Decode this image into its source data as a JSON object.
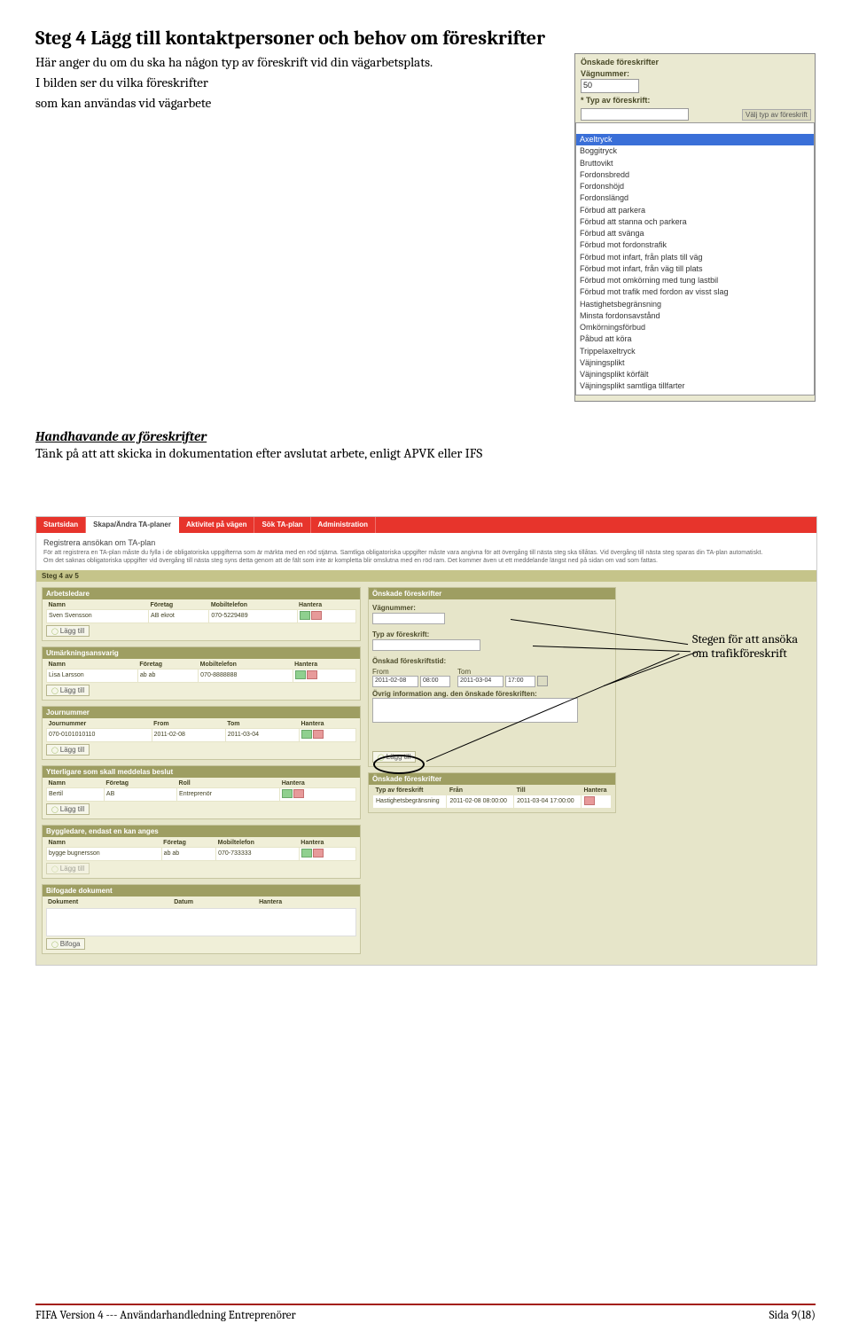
{
  "heading": "Steg 4 Lägg till kontaktpersoner och behov om föreskrifter",
  "intro_line": "Här anger du om du ska ha någon typ av föreskrift vid din vägarbetsplats.",
  "intro_line2a": "I bilden ser du vilka föreskrifter",
  "intro_line2b": "som kan användas vid vägarbete",
  "dropdown": {
    "top_label": "Önskade föreskrifter",
    "vagnummer_label": "Vägnummer:",
    "vagnummer_value": "50",
    "typ_label": "* Typ av föreskrift:",
    "hint": "Välj typ av föreskrift",
    "options": [
      "Axeltryck",
      "Boggitryck",
      "Bruttovikt",
      "Fordonsbredd",
      "Fordonshöjd",
      "Fordonslängd",
      "Förbud att parkera",
      "Förbud att stanna och parkera",
      "Förbud att svänga",
      "Förbud mot fordonstrafik",
      "Förbud mot infart, från plats till väg",
      "Förbud mot infart, från väg till plats",
      "Förbud mot omkörning med tung lastbil",
      "Förbud mot trafik med fordon av visst slag",
      "Hastighetsbegränsning",
      "Minsta fordonsavstånd",
      "Omkörningsförbud",
      "Påbud att köra",
      "Trippelaxeltryck",
      "Väjningsplikt",
      "Väjningsplikt körfält",
      "Väjningsplikt samtliga tillfarter"
    ]
  },
  "sub_heading": "Handhavande av föreskrifter",
  "sub_text": "Tänk på att att skicka in dokumentation efter avslutat arbete, enligt APVK eller IFS",
  "app_shot": {
    "nav": [
      "Startsidan",
      "Skapa/Ändra TA-planer",
      "Aktivitet på vägen",
      "Sök TA-plan",
      "Administration"
    ],
    "reg_title": "Registrera ansökan om TA-plan",
    "reg_desc1": "För att registrera en TA-plan måste du fylla i de obligatoriska uppgifterna som är märkta med en röd stjärna. Samtliga obligatoriska uppgifter måste vara angivna för att övergång till nästa steg ska tillåtas. Vid övergång till nästa steg sparas din TA-plan automatiskt.",
    "reg_desc2": "Om det saknas obligatoriska uppgifter vid övergång till nästa steg syns detta genom att de fält som inte är kompletta blir omslutna med en röd ram. Det kommer även ut ett meddelande längst ned på sidan om vad som fattas.",
    "step_bar": "Steg 4 av 5",
    "arbetsledare": {
      "title": "Arbetsledare",
      "hdr": [
        "Namn",
        "Företag",
        "Mobiltelefon",
        "Hantera"
      ],
      "row": [
        "Sven Svensson",
        "AB ekrot",
        "070-5229489",
        ""
      ]
    },
    "utmarkning": {
      "title": "Utmärkningsansvarig",
      "hdr": [
        "Namn",
        "Företag",
        "Mobiltelefon",
        "Hantera"
      ],
      "row": [
        "Lisa Larsson",
        "ab ab",
        "070-8888888",
        ""
      ]
    },
    "journummer": {
      "title": "Journummer",
      "hdr": [
        "Journummer",
        "From",
        "Tom",
        "Hantera"
      ],
      "row": [
        "070-0101010110",
        "2011-02-08",
        "2011-03-04",
        ""
      ]
    },
    "ytterligare": {
      "title": "Ytterligare som skall meddelas beslut",
      "hdr": [
        "Namn",
        "Företag",
        "Roll",
        "Hantera"
      ],
      "row": [
        "Bertil",
        "AB",
        "Entreprenör",
        ""
      ]
    },
    "byggledare": {
      "title": "Byggledare, endast en kan anges",
      "hdr": [
        "Namn",
        "Företag",
        "Mobiltelefon",
        "Hantera"
      ],
      "row": [
        "bygge bugnersson",
        "ab ab",
        "070-733333",
        ""
      ]
    },
    "bifogade": {
      "title": "Bifogade dokument",
      "hdr": [
        "Dokument",
        "Datum",
        "Hantera"
      ]
    },
    "btn_lagg": "Lägg till",
    "btn_bifoga": "Bifoga",
    "onskade": {
      "title": "Önskade föreskrifter",
      "vagnr_label": "Vägnummer:",
      "typ_label": "Typ av föreskrift:",
      "tid_label": "Önskad föreskriftstid:",
      "from_label": "From",
      "tom_label": "Tom",
      "from_date": "2011-02-08",
      "from_time": "08:00",
      "tom_date": "2011-03-04",
      "tom_time": "17:00",
      "ovrig_label": "Övrig information ang. den önskade föreskriften:"
    },
    "onskade_tbl": {
      "title": "Önskade föreskrifter",
      "hdr": [
        "Typ av föreskrift",
        "Från",
        "Till",
        "Hantera"
      ],
      "row": [
        "Hastighetsbegränsning",
        "2011-02-08 08:00:00",
        "2011-03-04 17:00:00",
        ""
      ]
    }
  },
  "annotation_text1": "Stegen för att ansöka",
  "annotation_text2": "om trafikföreskrift",
  "footer_left": "FIFA Version 4  ---  Användarhandledning Entreprenörer",
  "footer_right": "Sida 9(18)"
}
